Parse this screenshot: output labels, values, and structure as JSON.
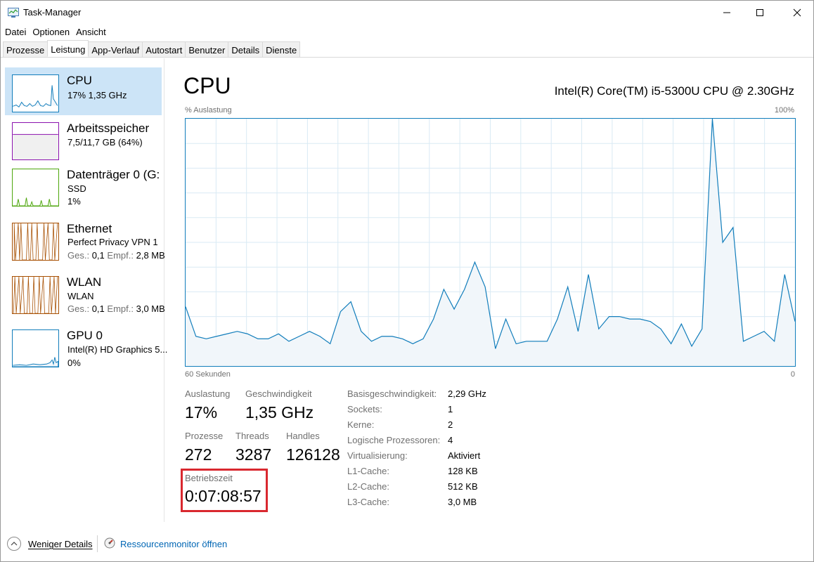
{
  "window": {
    "title": "Task-Manager",
    "icon": "task-manager-icon"
  },
  "menu": [
    "Datei",
    "Optionen",
    "Ansicht"
  ],
  "tabs": [
    "Prozesse",
    "Leistung",
    "App-Verlauf",
    "Autostart",
    "Benutzer",
    "Details",
    "Dienste"
  ],
  "active_tab": "Leistung",
  "sidebar": {
    "cpu": {
      "title": "CPU",
      "line1": "17%  1,35 GHz"
    },
    "memory": {
      "title": "Arbeitsspeicher",
      "line1": "7,5/11,7 GB (64%)"
    },
    "disk": {
      "title": "Datenträger 0 (G:",
      "line1": "SSD",
      "line2": "1%"
    },
    "ethernet": {
      "title": "Ethernet",
      "line1": "Perfect Privacy VPN 1",
      "send_label": "Ges.:",
      "send_value": "0,1",
      "recv_label": "Empf.:",
      "recv_value": "2,8 MB"
    },
    "wlan": {
      "title": "WLAN",
      "line1": "WLAN",
      "send_label": "Ges.:",
      "send_value": "0,1",
      "recv_label": "Empf.:",
      "recv_value": "3,0 MB"
    },
    "gpu": {
      "title": "GPU 0",
      "line1": "Intel(R) HD Graphics 5...",
      "line2": "0%"
    }
  },
  "main": {
    "title": "CPU",
    "model": "Intel(R) Core(TM) i5-5300U CPU @ 2.30GHz",
    "y_label": "% Auslastung",
    "y_max_label": "100%",
    "x_left_label": "60 Sekunden",
    "x_right_label": "0"
  },
  "chart_data": {
    "type": "area",
    "ylim": [
      0,
      100
    ],
    "grid": true,
    "color": "#117dbb",
    "values": [
      24,
      12,
      11,
      12,
      13,
      14,
      13,
      11,
      11,
      13,
      10,
      12,
      14,
      12,
      9,
      22,
      26,
      14,
      10,
      12,
      12,
      11,
      9,
      11,
      19,
      31,
      23,
      31,
      42,
      32,
      7,
      19,
      9,
      10,
      10,
      10,
      19,
      32,
      14,
      37,
      15,
      20,
      20,
      19,
      19,
      18,
      15,
      9,
      17,
      8,
      15,
      100,
      50,
      56,
      10,
      12,
      14,
      10,
      37,
      18
    ]
  },
  "stats": {
    "utilization_label": "Auslastung",
    "utilization_value": "17%",
    "speed_label": "Geschwindigkeit",
    "speed_value": "1,35 GHz",
    "processes_label": "Prozesse",
    "processes_value": "272",
    "threads_label": "Threads",
    "threads_value": "3287",
    "handles_label": "Handles",
    "handles_value": "126128",
    "uptime_label": "Betriebszeit",
    "uptime_value": "0:07:08:57"
  },
  "specs": [
    {
      "label": "Basisgeschwindigkeit:",
      "value": "2,29 GHz"
    },
    {
      "label": "Sockets:",
      "value": "1"
    },
    {
      "label": "Kerne:",
      "value": "2"
    },
    {
      "label": "Logische Prozessoren:",
      "value": "4"
    },
    {
      "label": "Virtualisierung:",
      "value": "Aktiviert"
    },
    {
      "label": "L1-Cache:",
      "value": "128 KB"
    },
    {
      "label": "L2-Cache:",
      "value": "512 KB"
    },
    {
      "label": "L3-Cache:",
      "value": "3,0 MB"
    }
  ],
  "footer": {
    "fewer_details": "Weniger Details",
    "resource_monitor": "Ressourcenmonitor öffnen"
  }
}
